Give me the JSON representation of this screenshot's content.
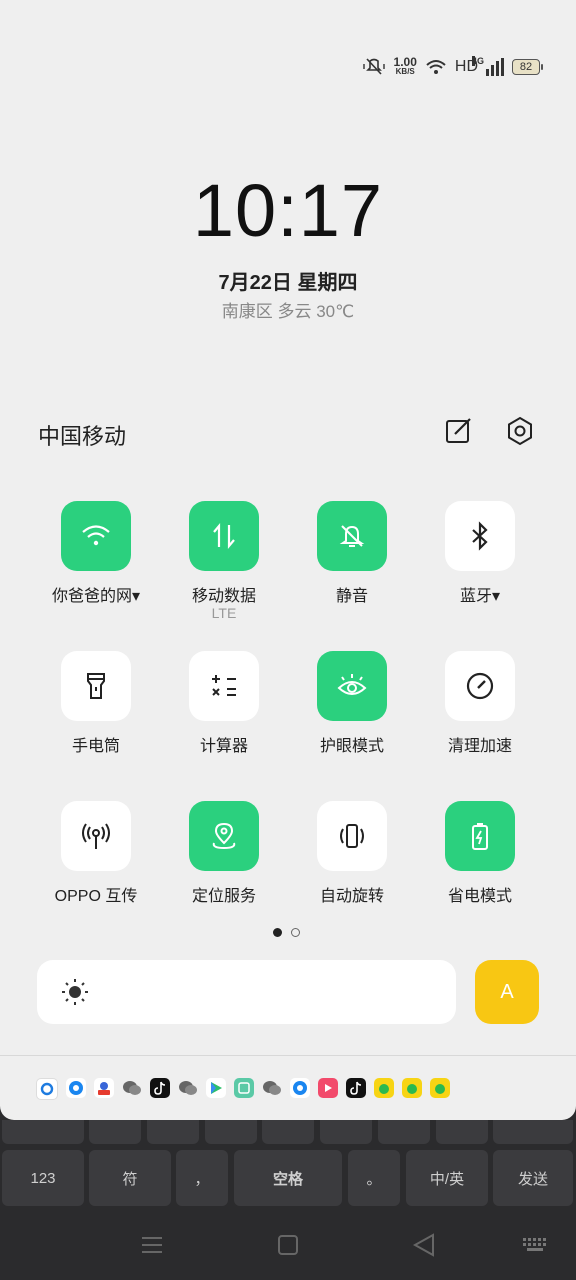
{
  "status": {
    "speed_value": "1.00",
    "speed_unit": "KB/S",
    "hd": "HD",
    "network": "4G",
    "battery": "82"
  },
  "lockscreen": {
    "time": "10:17",
    "date": "7月22日  星期四",
    "weather": "南康区 多云 30℃"
  },
  "panel": {
    "carrier": "中国移动",
    "tiles": [
      {
        "label": "你爸爸的网▾",
        "sub": "",
        "state": "on",
        "icon": "wifi-icon"
      },
      {
        "label": "移动数据",
        "sub": "LTE",
        "state": "on",
        "icon": "mobile-data-icon"
      },
      {
        "label": "静音",
        "sub": "",
        "state": "on",
        "icon": "mute-bell-icon"
      },
      {
        "label": "蓝牙▾",
        "sub": "",
        "state": "off",
        "icon": "bluetooth-icon"
      },
      {
        "label": "手电筒",
        "sub": "",
        "state": "off",
        "icon": "flashlight-icon"
      },
      {
        "label": "计算器",
        "sub": "",
        "state": "off",
        "icon": "calculator-icon"
      },
      {
        "label": "护眼模式",
        "sub": "",
        "state": "on",
        "icon": "eye-icon"
      },
      {
        "label": "清理加速",
        "sub": "",
        "state": "off",
        "icon": "speedometer-icon"
      },
      {
        "label": "OPPO 互传",
        "sub": "",
        "state": "off",
        "icon": "share-antenna-icon"
      },
      {
        "label": "定位服务",
        "sub": "",
        "state": "on",
        "icon": "location-icon"
      },
      {
        "label": "自动旋转",
        "sub": "",
        "state": "off",
        "icon": "rotate-icon"
      },
      {
        "label": "省电模式",
        "sub": "",
        "state": "on",
        "icon": "battery-saver-icon"
      }
    ],
    "auto_brightness": "A",
    "page_dots": 2,
    "active_page": 1
  },
  "notification_icons": [
    "browser",
    "qq-browser",
    "baidu",
    "wechat",
    "tiktok",
    "wechat",
    "play",
    "multitask",
    "wechat",
    "qq-browser",
    "video",
    "tiktok",
    "music",
    "music",
    "music"
  ],
  "keyboard": {
    "keys": [
      "123",
      "符",
      "，",
      "空格",
      "。",
      "中/英",
      "发送"
    ]
  },
  "colors": {
    "accent": "#2bd07e",
    "auto_brightness": "#f8c713"
  }
}
